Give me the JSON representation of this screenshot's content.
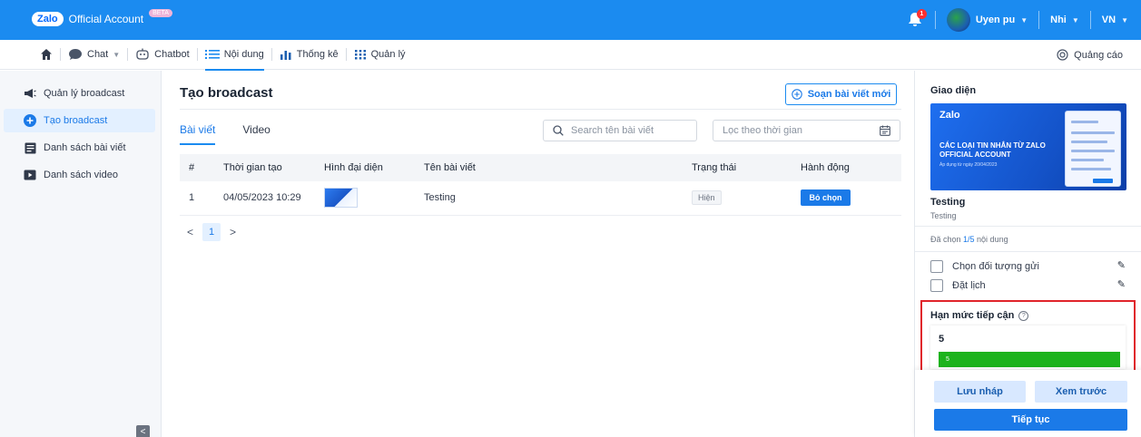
{
  "brand": {
    "logo": "Zalo",
    "name": "Official Account",
    "badge": "BETA"
  },
  "topbar": {
    "notification_count": "1",
    "user_name": "Uyen pu",
    "account": "Nhi",
    "language": "VN"
  },
  "nav": {
    "home_icon": "home-icon",
    "items": [
      {
        "label": "Chat",
        "icon": "chat-icon"
      },
      {
        "label": "Chatbot",
        "icon": "robot-icon"
      },
      {
        "label": "Nội dung",
        "icon": "list-icon",
        "active": true
      },
      {
        "label": "Thống kê",
        "icon": "bar-chart-icon"
      },
      {
        "label": "Quản lý",
        "icon": "grid-icon"
      }
    ],
    "ads_label": "Quảng cáo"
  },
  "sidebar": {
    "items": [
      {
        "label": "Quản lý broadcast",
        "icon": "megaphone-icon"
      },
      {
        "label": "Tạo broadcast",
        "icon": "plus-circle-icon",
        "active": true
      },
      {
        "label": "Danh sách bài viết",
        "icon": "article-icon"
      },
      {
        "label": "Danh sách video",
        "icon": "video-icon"
      }
    ]
  },
  "main": {
    "title": "Tạo broadcast",
    "compose_label": "Soạn bài viết mới",
    "tabs": [
      {
        "label": "Bài viết",
        "active": true
      },
      {
        "label": "Video"
      }
    ],
    "search_placeholder": "Search tên bài viết",
    "date_placeholder": "Lọc theo thời gian",
    "table": {
      "headers": [
        "#",
        "Thời gian tạo",
        "Hình đại diện",
        "Tên bài viết",
        "Trạng thái",
        "Hành động"
      ],
      "rows": [
        {
          "index": "1",
          "created": "04/05/2023 10:29",
          "name": "Testing",
          "status": "Hiện",
          "action": "Bỏ chọn"
        }
      ]
    },
    "pager": {
      "prev": "<",
      "current": "1",
      "next": ">"
    }
  },
  "rightpanel": {
    "title": "Giao diện",
    "banner": {
      "logo": "Zalo",
      "headline": "CÁC LOẠI TIN NHẮN TỪ ZALO OFFICIAL ACCOUNT",
      "subline": "Áp dụng từ ngày 20/04/2023"
    },
    "item_title": "Testing",
    "item_sub": "Testing",
    "selected_prefix": "Đã chọn ",
    "selected_count": "1/5",
    "selected_suffix": " nội dung",
    "options": [
      {
        "label": "Chọn đối tượng gửi"
      },
      {
        "label": "Đặt lịch"
      }
    ],
    "quota": {
      "title": "Hạn mức tiếp cận",
      "value": "5",
      "bar_label": "5",
      "bar_fraction": 1.0
    },
    "buttons": {
      "draft": "Lưu nháp",
      "preview": "Xem trước",
      "continue": "Tiếp tục"
    }
  }
}
